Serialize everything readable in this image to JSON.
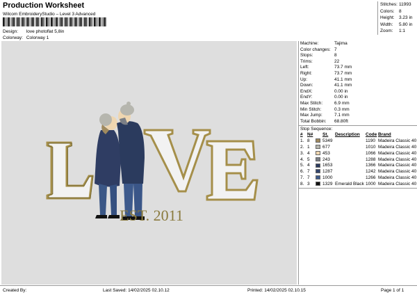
{
  "header": {
    "title": "Production Worksheet",
    "software": "Wilcom EmbroideryStudio – Level 3 Advanced",
    "design_label": "Design:",
    "design_value": "love photoflat 5,8in",
    "colorway_label": "Colorway:",
    "colorway_value": "Colorway 1"
  },
  "summary": [
    {
      "label": "Stitches:",
      "value": "11993"
    },
    {
      "label": "Colors:",
      "value": "8"
    },
    {
      "label": "Height:",
      "value": "3.23 in"
    },
    {
      "label": "Width:",
      "value": "5.80 in"
    },
    {
      "label": "Zoom:",
      "value": "1:1"
    }
  ],
  "details": [
    {
      "label": "Machine:",
      "value": "Tajima"
    },
    {
      "label": "Color changes:",
      "value": "7"
    },
    {
      "label": "Stops:",
      "value": "8"
    },
    {
      "label": "Trims:",
      "value": "22"
    },
    {
      "label": "Left:",
      "value": "73.7 mm"
    },
    {
      "label": "Right:",
      "value": "73.7 mm"
    },
    {
      "label": "Up:",
      "value": "41.1 mm"
    },
    {
      "label": "Down:",
      "value": "41.1 mm"
    },
    {
      "label": "EndX:",
      "value": "0.00 in"
    },
    {
      "label": "EndY:",
      "value": "0.00 in"
    },
    {
      "label": "Max Stitch:",
      "value": "6.9 mm"
    },
    {
      "label": "Min Stitch:",
      "value": "0.3 mm"
    },
    {
      "label": "Max Jump:",
      "value": "7.1 mm"
    },
    {
      "label": "Total Bobbin:",
      "value": "68.80ft"
    }
  ],
  "stop_sequence": {
    "title": "Stop Sequence:",
    "columns": [
      "#",
      "N#",
      "",
      "St.",
      "Description",
      "Code",
      "Brand"
    ],
    "rows": [
      {
        "idx": "1.",
        "n": "8",
        "color": "#a08a5e",
        "st": "5349",
        "desc": "",
        "code": "1190",
        "brand": "Madeira Classic 40"
      },
      {
        "idx": "2.",
        "n": "1",
        "color": "#b6b6ae",
        "st": "677",
        "desc": "",
        "code": "1010",
        "brand": "Madeira Classic 40"
      },
      {
        "idx": "3.",
        "n": "4",
        "color": "#efd6b0",
        "st": "453",
        "desc": "",
        "code": "1066",
        "brand": "Madeira Classic 40"
      },
      {
        "idx": "4.",
        "n": "5",
        "color": "#7b7f86",
        "st": "243",
        "desc": "",
        "code": "1288",
        "brand": "Madeira Classic 40"
      },
      {
        "idx": "5.",
        "n": "4",
        "color": "#2b3b5e",
        "st": "1653",
        "desc": "",
        "code": "1366",
        "brand": "Madeira Classic 40"
      },
      {
        "idx": "6.",
        "n": "7",
        "color": "#33456e",
        "st": "1287",
        "desc": "",
        "code": "1242",
        "brand": "Madeira Classic 40"
      },
      {
        "idx": "7.",
        "n": "7",
        "color": "#3d5a8c",
        "st": "1000",
        "desc": "",
        "code": "1266",
        "brand": "Madeira Classic 40"
      },
      {
        "idx": "8.",
        "n": "3",
        "color": "#111111",
        "st": "1329",
        "desc": "Emerald Black",
        "code": "1000",
        "brand": "Madeira Classic 40"
      }
    ]
  },
  "artwork": {
    "word": "LOVE",
    "est_text": "EST. 2011",
    "outline_color": "#a58f4a",
    "fill_color": "#f2f2f2",
    "text_color": "#8a7a3e"
  },
  "footer": {
    "created_by": "Created By:",
    "last_saved": "Last Saved: 14/02/2025 02.10.12",
    "printed": "Printed: 14/02/2025 02.10.15",
    "page": "Page 1 of 1"
  }
}
